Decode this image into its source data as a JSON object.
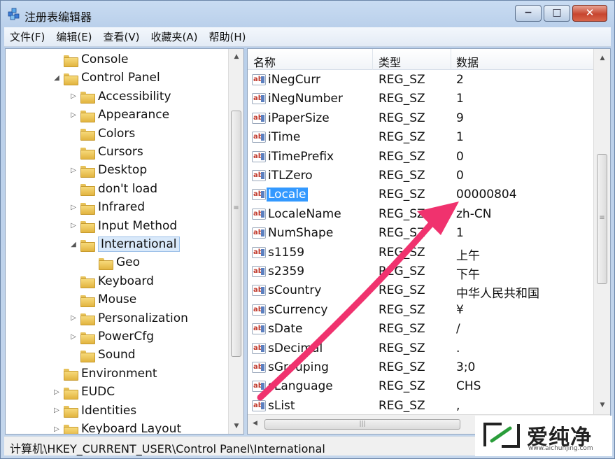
{
  "window": {
    "title": "注册表编辑器"
  },
  "caption": {
    "minimize": "−",
    "maximize": "□",
    "close": "✕"
  },
  "menu": [
    "文件(F)",
    "编辑(E)",
    "查看(V)",
    "收藏夹(A)",
    "帮助(H)"
  ],
  "tree": [
    {
      "label": "Console",
      "level": 1,
      "expander": ""
    },
    {
      "label": "Control Panel",
      "level": 1,
      "expander": "◢"
    },
    {
      "label": "Accessibility",
      "level": 2,
      "expander": "▷"
    },
    {
      "label": "Appearance",
      "level": 2,
      "expander": "▷"
    },
    {
      "label": "Colors",
      "level": 2,
      "expander": ""
    },
    {
      "label": "Cursors",
      "level": 2,
      "expander": ""
    },
    {
      "label": "Desktop",
      "level": 2,
      "expander": "▷"
    },
    {
      "label": "don't load",
      "level": 2,
      "expander": ""
    },
    {
      "label": "Infrared",
      "level": 2,
      "expander": "▷"
    },
    {
      "label": "Input Method",
      "level": 2,
      "expander": "▷"
    },
    {
      "label": "International",
      "level": 2,
      "expander": "◢",
      "selected": true
    },
    {
      "label": "Geo",
      "level": 3,
      "expander": ""
    },
    {
      "label": "Keyboard",
      "level": 2,
      "expander": ""
    },
    {
      "label": "Mouse",
      "level": 2,
      "expander": ""
    },
    {
      "label": "Personalization",
      "level": 2,
      "expander": "▷"
    },
    {
      "label": "PowerCfg",
      "level": 2,
      "expander": "▷"
    },
    {
      "label": "Sound",
      "level": 2,
      "expander": ""
    },
    {
      "label": "Environment",
      "level": 1,
      "expander": ""
    },
    {
      "label": "EUDC",
      "level": 1,
      "expander": "▷"
    },
    {
      "label": "Identities",
      "level": 1,
      "expander": "▷"
    },
    {
      "label": "Keyboard Layout",
      "level": 1,
      "expander": "▷"
    }
  ],
  "list": {
    "columns": {
      "name": "名称",
      "type": "类型",
      "data": "数据"
    },
    "rows": [
      {
        "name": "iNegCurr",
        "type": "REG_SZ",
        "data": "2"
      },
      {
        "name": "iNegNumber",
        "type": "REG_SZ",
        "data": "1"
      },
      {
        "name": "iPaperSize",
        "type": "REG_SZ",
        "data": "9"
      },
      {
        "name": "iTime",
        "type": "REG_SZ",
        "data": "1"
      },
      {
        "name": "iTimePrefix",
        "type": "REG_SZ",
        "data": "0"
      },
      {
        "name": "iTLZero",
        "type": "REG_SZ",
        "data": "0"
      },
      {
        "name": "Locale",
        "type": "REG_SZ",
        "data": "00000804",
        "selected": true
      },
      {
        "name": "LocaleName",
        "type": "REG_SZ",
        "data": "zh-CN"
      },
      {
        "name": "NumShape",
        "type": "REG_SZ",
        "data": "1"
      },
      {
        "name": "s1159",
        "type": "REG_SZ",
        "data": "上午"
      },
      {
        "name": "s2359",
        "type": "REG_SZ",
        "data": "下午"
      },
      {
        "name": "sCountry",
        "type": "REG_SZ",
        "data": "中华人民共和国"
      },
      {
        "name": "sCurrency",
        "type": "REG_SZ",
        "data": "¥"
      },
      {
        "name": "sDate",
        "type": "REG_SZ",
        "data": "/"
      },
      {
        "name": "sDecimal",
        "type": "REG_SZ",
        "data": "."
      },
      {
        "name": "sGrouping",
        "type": "REG_SZ",
        "data": "3;0"
      },
      {
        "name": "sLanguage",
        "type": "REG_SZ",
        "data": "CHS"
      },
      {
        "name": "sList",
        "type": "REG_SZ",
        "data": ","
      }
    ]
  },
  "value_icon": "ab",
  "status": {
    "path": "计算机\\HKEY_CURRENT_USER\\Control Panel\\International"
  },
  "annotation": {
    "arrow_color": "#f0326e"
  },
  "watermark": {
    "text": "爱纯净",
    "url": "www.aichunjing.com"
  }
}
